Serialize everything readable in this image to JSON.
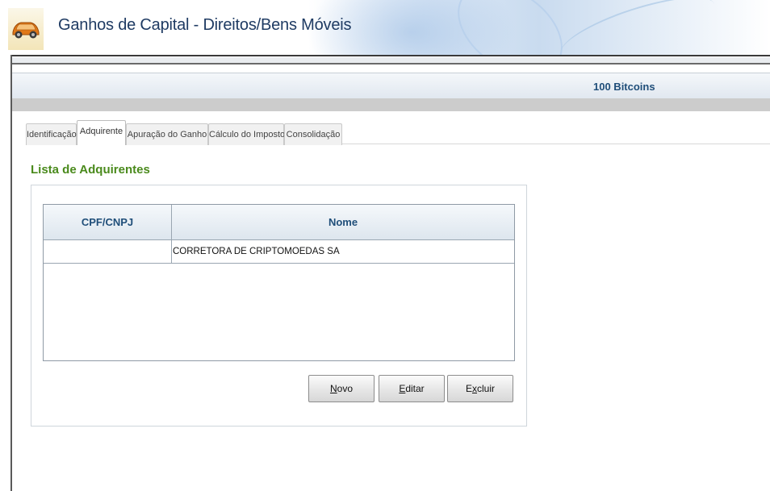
{
  "header": {
    "title": "Ganhos de Capital - Direitos/Bens Móveis",
    "app_icon": "car-icon"
  },
  "info_bar": {
    "text": "100 Bitcoins"
  },
  "tabs": [
    {
      "label": "Identificação",
      "active": false
    },
    {
      "label": "Adquirente",
      "active": true
    },
    {
      "label": "Apuração do Ganho",
      "active": false
    },
    {
      "label": "Cálculo do Imposto",
      "active": false
    },
    {
      "label": "Consolidação",
      "active": false
    }
  ],
  "section": {
    "title": "Lista de Adquirentes"
  },
  "grid": {
    "columns": [
      "CPF/CNPJ",
      "Nome"
    ],
    "rows": [
      {
        "cpf_cnpj": "",
        "nome": "CORRETORA DE CRIPTOMOEDAS SA"
      }
    ]
  },
  "buttons": {
    "novo": {
      "mnemonic": "N",
      "rest": "ovo"
    },
    "editar": {
      "mnemonic": "E",
      "rest": "ditar"
    },
    "excluir": {
      "pre": "E",
      "mnemonic": "x",
      "rest": "cluir"
    }
  },
  "colors": {
    "title_blue": "#1f3b63",
    "section_green": "#4a8a1c",
    "header_text_blue": "#1f4e79"
  }
}
